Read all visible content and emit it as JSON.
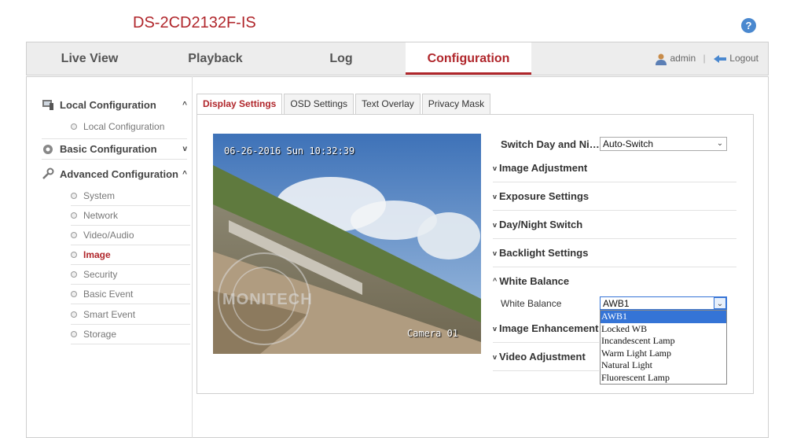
{
  "header": {
    "device_title": "DS-2CD2132F-IS",
    "help_icon": "?"
  },
  "nav": {
    "tabs": [
      {
        "label": "Live View"
      },
      {
        "label": "Playback"
      },
      {
        "label": "Log"
      },
      {
        "label": "Configuration",
        "active": true
      }
    ],
    "user": "admin",
    "separator": "|",
    "logout": "Logout"
  },
  "sidebar": {
    "local": {
      "label": "Local Configuration",
      "chevron": "^",
      "items": [
        {
          "label": "Local Configuration"
        }
      ]
    },
    "basic": {
      "label": "Basic Configuration",
      "chevron": "v"
    },
    "advanced": {
      "label": "Advanced Configuration",
      "chevron": "^",
      "items": [
        {
          "label": "System"
        },
        {
          "label": "Network"
        },
        {
          "label": "Video/Audio"
        },
        {
          "label": "Image",
          "active": true
        },
        {
          "label": "Security"
        },
        {
          "label": "Basic Event"
        },
        {
          "label": "Smart Event"
        },
        {
          "label": "Storage"
        }
      ]
    }
  },
  "tabs": [
    {
      "label": "Display Settings",
      "active": true
    },
    {
      "label": "OSD Settings"
    },
    {
      "label": "Text Overlay"
    },
    {
      "label": "Privacy Mask"
    }
  ],
  "video": {
    "timestamp": "06-26-2016 Sun 10:32:39",
    "camera_name": "Camera 01",
    "watermark": "MONITECH"
  },
  "settings": {
    "switch_day_night": {
      "label": "Switch Day and Ni…",
      "value": "Auto-Switch"
    },
    "sections": [
      {
        "label": "Image Adjustment",
        "caret": "v"
      },
      {
        "label": "Exposure Settings",
        "caret": "v"
      },
      {
        "label": "Day/Night Switch",
        "caret": "v"
      },
      {
        "label": "Backlight Settings",
        "caret": "v"
      },
      {
        "label": "White Balance",
        "caret": "^"
      },
      {
        "label": "Image Enhancement",
        "caret": "v"
      },
      {
        "label": "Video Adjustment",
        "caret": "v"
      }
    ],
    "white_balance": {
      "label": "White Balance",
      "value": "AWB1",
      "options": [
        "AWB1",
        "Locked WB",
        "Incandescent Lamp",
        "Warm Light Lamp",
        "Natural Light",
        "Fluorescent Lamp"
      ],
      "selected_index": 0
    }
  },
  "colors": {
    "accent": "#b0262b",
    "selection": "#3574d6"
  }
}
